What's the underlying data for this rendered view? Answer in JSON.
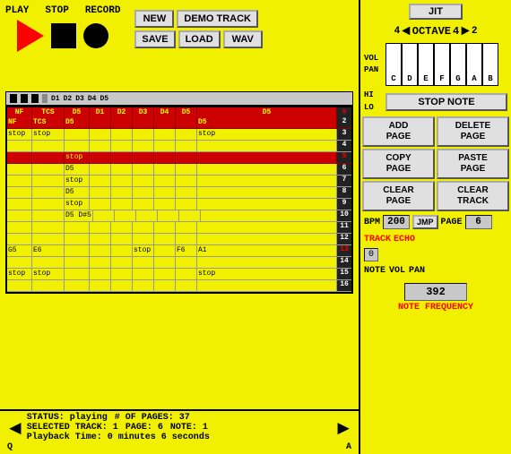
{
  "header": {
    "transport": {
      "play_label": "PLAY",
      "stop_label": "STOP",
      "record_label": "RECORD"
    },
    "file_buttons": {
      "new_label": "NEW",
      "demo_label": "DEMO TRACK",
      "save_label": "SAVE",
      "load_label": "LOAD",
      "wav_label": "WAV"
    }
  },
  "right_panel": {
    "jit_label": "JIT",
    "octave": {
      "number": "4",
      "label": "OCTAVE"
    },
    "piano_keys": [
      "C",
      "D",
      "E",
      "F",
      "G",
      "A",
      "B"
    ],
    "vol_label": "VOL",
    "pan_label": "PAN",
    "hi_label": "HI",
    "lo_label": "LO",
    "stop_note_label": "STOP NOTE",
    "add_page_label": "ADD\nPAGE",
    "delete_page_label": "DELETE\nPAGE",
    "copy_page_label": "COPY\nPAGE",
    "paste_page_label": "PASTE\nPAGE",
    "clear_page_label": "CLEAR\nPAGE",
    "clear_track_label": "CLEAR\nTRACK",
    "bpm_label": "BPM",
    "bpm_value": "200",
    "jmp_label": "JMP",
    "page_label": "PAGE",
    "page_value": "6",
    "track_label": "TRACK",
    "echo_label": "ECHO",
    "echo_value": "0",
    "note_label": "NOTE",
    "vol_short": "VOL",
    "pan_short": "PAN",
    "frequency_value": "392",
    "note_freq_label": "NOTE FREQUENCY"
  },
  "scrollbar": {
    "labels": [
      "D1",
      "D2",
      "D3",
      "D4",
      "D5"
    ]
  },
  "sequencer": {
    "header_cols": [
      "NF",
      "TCS",
      "D5",
      "D1",
      "D2",
      "D3",
      "D4",
      "D5",
      "D5",
      "#"
    ],
    "rows": [
      {
        "num": "2",
        "cells": [
          "",
          "",
          "",
          "",
          "",
          "",
          "",
          "",
          "",
          "",
          "",
          "",
          "",
          "",
          "",
          ""
        ],
        "highlight": false
      },
      {
        "num": "3",
        "cells": [
          "stop",
          "stop",
          "",
          "",
          "",
          "",
          "",
          "",
          "",
          "",
          "",
          "",
          "",
          "",
          "",
          "stop"
        ],
        "highlight": false
      },
      {
        "num": "4",
        "cells": [
          "",
          "",
          "",
          "",
          "",
          "",
          "",
          "",
          "",
          "",
          "",
          "",
          "",
          "",
          "",
          ""
        ],
        "highlight": false
      },
      {
        "num": "5",
        "cells": [
          "",
          "",
          "",
          "stop",
          "",
          "",
          "",
          "",
          "",
          "",
          "",
          "",
          "",
          "",
          "",
          ""
        ],
        "highlight": true,
        "red_num": true
      },
      {
        "num": "6",
        "cells": [
          "",
          "",
          "",
          "D5",
          "",
          "",
          "",
          "",
          "",
          "",
          "",
          "",
          "",
          "",
          "",
          ""
        ],
        "highlight": false
      },
      {
        "num": "7",
        "cells": [
          "",
          "",
          "",
          "stop",
          "",
          "",
          "",
          "",
          "",
          "",
          "",
          "",
          "",
          "",
          "",
          ""
        ],
        "highlight": false
      },
      {
        "num": "8",
        "cells": [
          "",
          "",
          "",
          "D5",
          "",
          "",
          "",
          "",
          "",
          "",
          "",
          "",
          "",
          "",
          "",
          ""
        ],
        "highlight": false
      },
      {
        "num": "9",
        "cells": [
          "",
          "",
          "",
          "stop",
          "",
          "",
          "",
          "",
          "",
          "",
          "",
          "",
          "",
          "",
          "",
          ""
        ],
        "highlight": false
      },
      {
        "num": "10",
        "cells": [
          "",
          "",
          "",
          "D5 D#5",
          "",
          "",
          "",
          "",
          "",
          "",
          "",
          "",
          "",
          "",
          "",
          ""
        ],
        "highlight": false
      },
      {
        "num": "11",
        "cells": [
          "",
          "",
          "",
          "",
          "",
          "",
          "",
          "",
          "",
          "",
          "",
          "",
          "",
          "",
          "",
          ""
        ],
        "highlight": false
      },
      {
        "num": "12",
        "cells": [
          "",
          "",
          "",
          "",
          "",
          "",
          "",
          "",
          "",
          "",
          "",
          "",
          "",
          "",
          "",
          ""
        ],
        "highlight": false
      },
      {
        "num": "13",
        "cells": [
          "G5",
          "E6",
          "",
          "",
          "",
          "stop",
          "",
          "F6",
          "",
          "",
          "",
          "",
          "",
          "",
          "",
          "A1"
        ],
        "highlight": false,
        "red_num": true
      },
      {
        "num": "14",
        "cells": [
          "",
          "",
          "",
          "",
          "",
          "",
          "",
          "",
          "",
          "",
          "",
          "",
          "",
          "",
          "",
          ""
        ],
        "highlight": false
      },
      {
        "num": "15",
        "cells": [
          "stop",
          "stop",
          "",
          "",
          "",
          "",
          "",
          "",
          "",
          "",
          "",
          "",
          "",
          "",
          "",
          "stop"
        ],
        "highlight": false
      },
      {
        "num": "16",
        "cells": [
          "",
          "",
          "",
          "",
          "",
          "",
          "",
          "",
          "",
          "",
          "",
          "",
          "",
          "",
          "",
          ""
        ],
        "highlight": false
      }
    ]
  },
  "status_bar": {
    "status": "STATUS: playing",
    "pages": "# OF PAGES: 37",
    "selected_track": "SELECTED TRACK: 1",
    "page": "PAGE: 6",
    "note": "NOTE: 1",
    "playback_time": "Playback Time: 0 minutes 6 seconds",
    "nav_left": "Q",
    "nav_right": "A"
  }
}
